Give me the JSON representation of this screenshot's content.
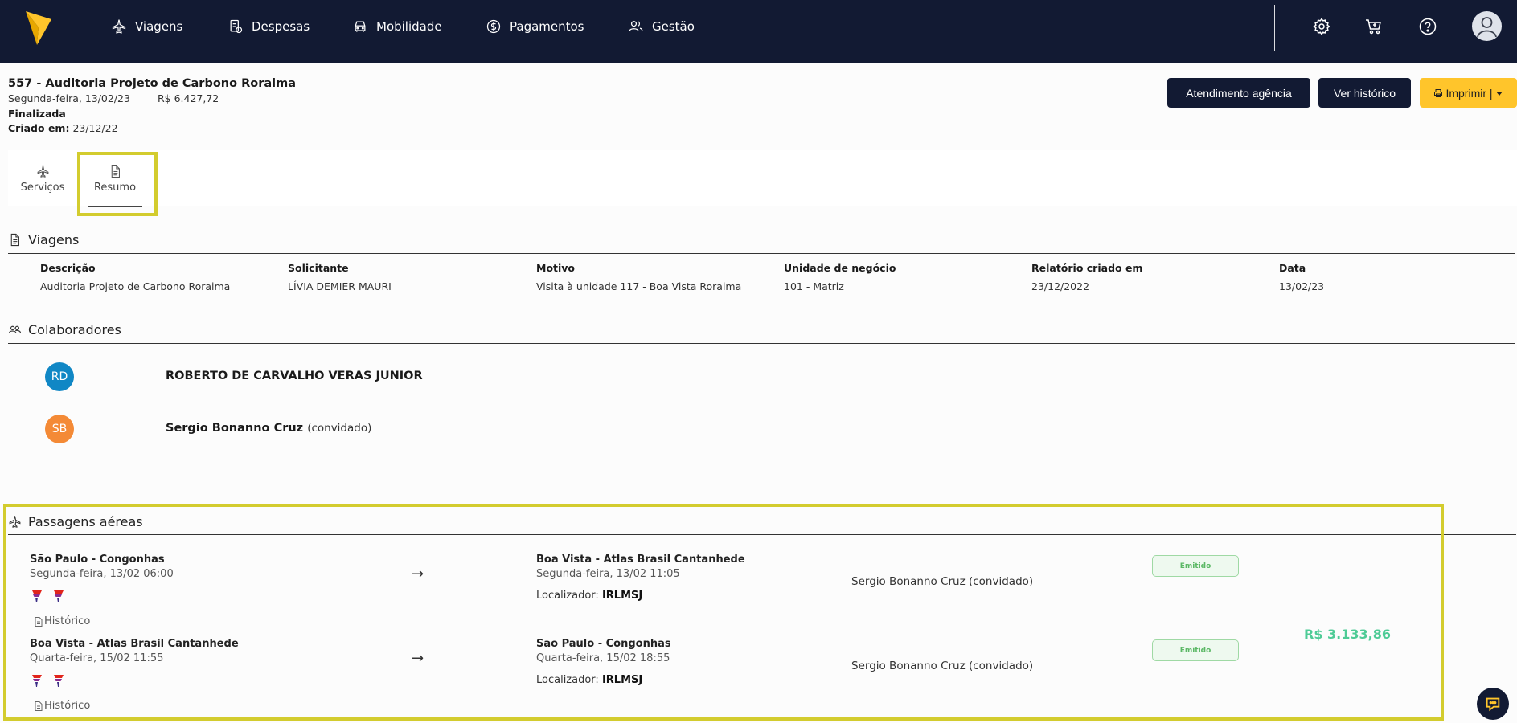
{
  "nav": {
    "items": [
      {
        "label": "Viagens",
        "icon": "plane-icon"
      },
      {
        "label": "Despesas",
        "icon": "receipt-icon"
      },
      {
        "label": "Mobilidade",
        "icon": "car-icon"
      },
      {
        "label": "Pagamentos",
        "icon": "dollar-icon"
      },
      {
        "label": "Gestão",
        "icon": "users-icon"
      }
    ],
    "right_icons": [
      "gear-icon",
      "cart-icon",
      "help-icon",
      "user-avatar-icon"
    ]
  },
  "trip": {
    "title": "557 - Auditoria Projeto de Carbono Roraima",
    "date": "Segunda-feira, 13/02/23",
    "total": "R$ 6.427,72",
    "status": "Finalizada",
    "created_label": "Criado em:",
    "created_value": "23/12/22"
  },
  "actions": {
    "agency": "Atendimento agência",
    "history": "Ver histórico",
    "print": "Imprimir |"
  },
  "tabs": [
    {
      "label": "Serviços",
      "icon": "plane-icon"
    },
    {
      "label": "Resumo",
      "icon": "document-icon",
      "active": true
    }
  ],
  "viagens": {
    "title": "Viagens",
    "columns": [
      "Descrição",
      "Solicitante",
      "Motivo",
      "Unidade de negócio",
      "Relatório criado em",
      "Data"
    ],
    "values": [
      "Auditoria Projeto de Carbono Roraima",
      "LÍVIA DEMIER MAURI",
      "Visita à unidade 117 - Boa Vista Roraima",
      "101 - Matriz",
      "23/12/2022",
      "13/02/23"
    ]
  },
  "colaboradores": {
    "title": "Colaboradores",
    "people": [
      {
        "initials": "RD",
        "name": "ROBERTO DE CARVALHO VERAS JUNIOR",
        "note": "",
        "color": "#1087c5"
      },
      {
        "initials": "SB",
        "name": "Sergio Bonanno Cruz",
        "note": "(convidado)",
        "color": "#f48a36"
      }
    ]
  },
  "passagens": {
    "title": "Passagens aéreas",
    "price": "R$ 3.133,86",
    "flights": [
      {
        "origin": "São Paulo - Congonhas",
        "origin_date": "Segunda-feira, 13/02 06:00",
        "destination": "Boa Vista - Atlas Brasil Cantanhede",
        "destination_date": "Segunda-feira, 13/02 11:05",
        "locator_label": "Localizador:",
        "locator": "IRLMSJ",
        "passenger": "Sergio Bonanno Cruz (convidado)",
        "status": "Emitido",
        "history": "Histórico",
        "arrow": "→"
      },
      {
        "origin": "Boa Vista - Atlas Brasil Cantanhede",
        "origin_date": "Quarta-feira, 15/02 11:55",
        "destination": "São Paulo - Congonhas",
        "destination_date": "Quarta-feira, 15/02 18:55",
        "locator_label": "Localizador:",
        "locator": "IRLMSJ",
        "passenger": "Sergio Bonanno Cruz (convidado)",
        "status": "Emitido",
        "history": "Histórico",
        "arrow": "→"
      }
    ]
  },
  "colors": {
    "nav_bg": "#121a33",
    "accent_yellow": "#ffc52b",
    "highlight": "#d3cc2e",
    "price_green": "#4ecb96",
    "badge_green": "#5bb865"
  }
}
